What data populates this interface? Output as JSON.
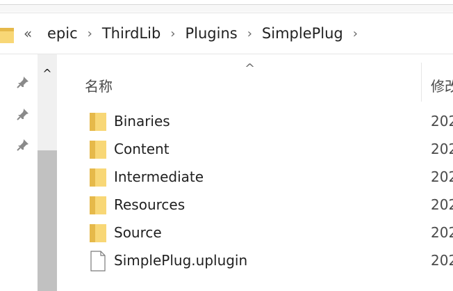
{
  "address_bar": {
    "overflow": "«",
    "separator": "›",
    "breadcrumbs": [
      "epic",
      "ThirdLib",
      "Plugins",
      "SimplePlug"
    ]
  },
  "navigation_pane": {
    "pins": [
      "pin-icon",
      "pin-icon",
      "pin-icon"
    ],
    "scroll_up": "^"
  },
  "file_list": {
    "sort_indicator": "^",
    "columns": {
      "name": "名称",
      "date": "修改"
    },
    "items": [
      {
        "name": "Binaries",
        "type": "folder",
        "date": "202"
      },
      {
        "name": "Content",
        "type": "folder",
        "date": "202"
      },
      {
        "name": "Intermediate",
        "type": "folder",
        "date": "202"
      },
      {
        "name": "Resources",
        "type": "folder",
        "date": "202"
      },
      {
        "name": "Source",
        "type": "folder",
        "date": "202"
      },
      {
        "name": "SimplePlug.uplugin",
        "type": "file",
        "date": "202"
      }
    ]
  },
  "colors": {
    "folder_fill": "#f8d776",
    "folder_dark": "#e6b94a",
    "scroll_thumb": "#c1c1c1"
  }
}
